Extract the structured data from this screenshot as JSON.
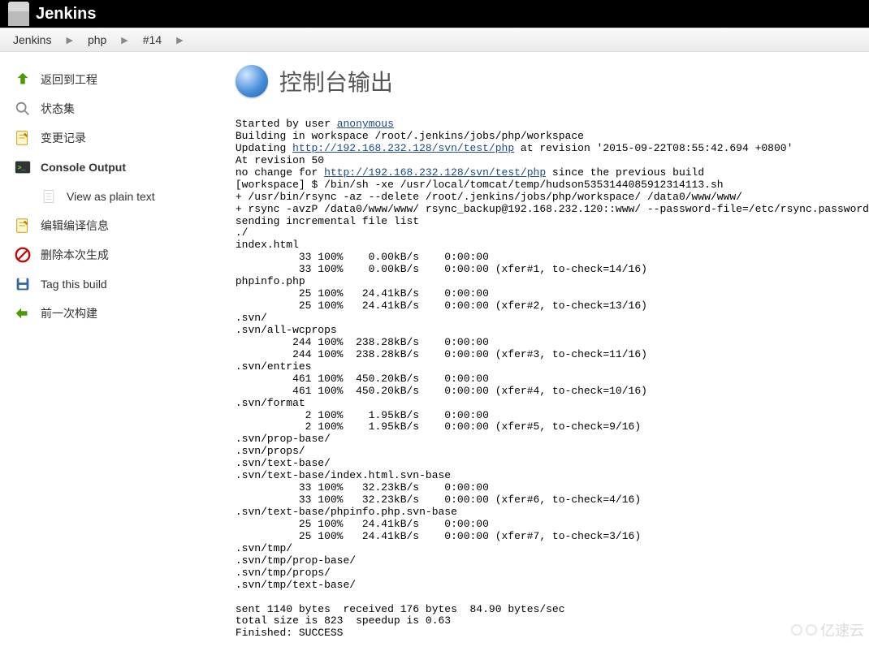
{
  "header": {
    "brand": "Jenkins"
  },
  "breadcrumb": {
    "items": [
      "Jenkins",
      "php",
      "#14"
    ]
  },
  "sidebar": {
    "items": [
      {
        "label": "返回到工程"
      },
      {
        "label": "状态集"
      },
      {
        "label": "变更记录"
      },
      {
        "label": "Console Output"
      },
      {
        "label": "View as plain text"
      },
      {
        "label": "编辑编译信息"
      },
      {
        "label": "删除本次生成"
      },
      {
        "label": "Tag this build"
      },
      {
        "label": "前一次构建"
      }
    ]
  },
  "page": {
    "title": "控制台输出"
  },
  "console": {
    "line_started_by": "Started by user ",
    "user_link": "anonymous",
    "line_building": "Building in workspace /root/.jenkins/jobs/php/workspace",
    "line_updating_prefix": "Updating ",
    "svn_url": "http://192.168.232.128/svn/test/php",
    "line_updating_suffix": " at revision '2015-09-22T08:55:42.694 +0800'",
    "line_at_rev": "At revision 50",
    "line_nochange_prefix": "no change for ",
    "line_nochange_suffix": " since the previous build",
    "line_ws_shell": "[workspace] $ /bin/sh -xe /usr/local/tomcat/temp/hudson5353144085912314113.sh",
    "line_rsync1": "+ /usr/bin/rsync -az --delete /root/.jenkins/jobs/php/workspace/ /data0/www/www/",
    "line_rsync2": "+ rsync -avzP /data0/www/www/ rsync_backup@192.168.232.120::www/ --password-file=/etc/rsync.password",
    "line_sending": "sending incremental file list",
    "body_rest": "./\nindex.html\n          33 100%    0.00kB/s    0:00:00\n          33 100%    0.00kB/s    0:00:00 (xfer#1, to-check=14/16)\nphpinfo.php\n          25 100%   24.41kB/s    0:00:00\n          25 100%   24.41kB/s    0:00:00 (xfer#2, to-check=13/16)\n.svn/\n.svn/all-wcprops\n         244 100%  238.28kB/s    0:00:00\n         244 100%  238.28kB/s    0:00:00 (xfer#3, to-check=11/16)\n.svn/entries\n         461 100%  450.20kB/s    0:00:00\n         461 100%  450.20kB/s    0:00:00 (xfer#4, to-check=10/16)\n.svn/format\n           2 100%    1.95kB/s    0:00:00\n           2 100%    1.95kB/s    0:00:00 (xfer#5, to-check=9/16)\n.svn/prop-base/\n.svn/props/\n.svn/text-base/\n.svn/text-base/index.html.svn-base\n          33 100%   32.23kB/s    0:00:00\n          33 100%   32.23kB/s    0:00:00 (xfer#6, to-check=4/16)\n.svn/text-base/phpinfo.php.svn-base\n          25 100%   24.41kB/s    0:00:00\n          25 100%   24.41kB/s    0:00:00 (xfer#7, to-check=3/16)\n.svn/tmp/\n.svn/tmp/prop-base/\n.svn/tmp/props/\n.svn/tmp/text-base/\n\nsent 1140 bytes  received 176 bytes  84.90 bytes/sec\ntotal size is 823  speedup is 0.63\nFinished: SUCCESS"
  },
  "watermark": "亿速云"
}
